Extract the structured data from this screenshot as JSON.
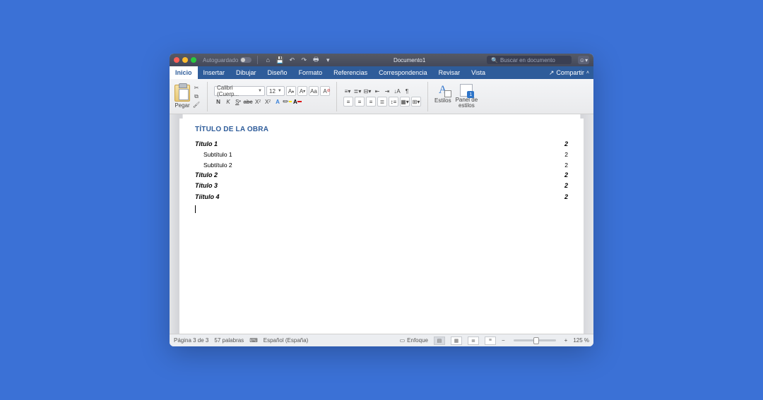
{
  "titlebar": {
    "autosave_label": "Autoguardado",
    "doc_title": "Documento1",
    "search_placeholder": "Buscar en documento"
  },
  "menu": {
    "tabs": [
      "Inicio",
      "Insertar",
      "Dibujar",
      "Diseño",
      "Formato",
      "Referencias",
      "Correspondencia",
      "Revisar",
      "Vista"
    ],
    "active_index": 0,
    "share": "Compartir"
  },
  "ribbon": {
    "paste": "Pegar",
    "font_name": "Calibri (Cuerp...",
    "font_size": "12",
    "styles": "Estilos",
    "styles_panel": "Panel de\nestilos"
  },
  "document": {
    "heading": "TÍTULO DE LA OBRA",
    "toc": [
      {
        "text": "Título 1",
        "page": "2",
        "level": 0
      },
      {
        "text": "Subtítulo 1",
        "page": "2",
        "level": 1
      },
      {
        "text": "Subtítulo 2",
        "page": "2",
        "level": 1
      },
      {
        "text": "Título 2",
        "page": "2",
        "level": 0
      },
      {
        "text": "Título 3",
        "page": "2",
        "level": 0
      },
      {
        "text": "Tíitulo 4",
        "page": "2",
        "level": 0
      }
    ]
  },
  "status": {
    "page": "Página 3 de 3",
    "words": "57 palabras",
    "lang": "Español (España)",
    "focus": "Enfoque",
    "zoom": "125 %"
  }
}
